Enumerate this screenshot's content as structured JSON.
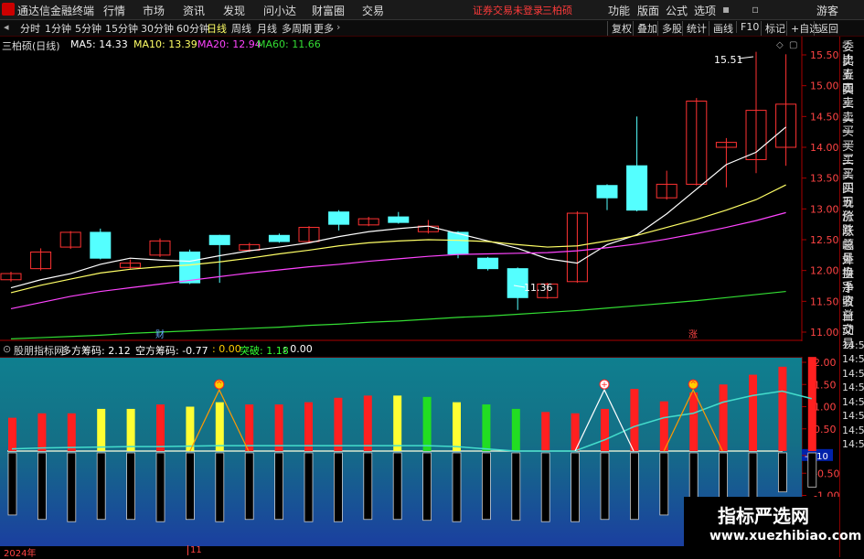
{
  "app": {
    "title": "通达信金融终端"
  },
  "menu": [
    "行情",
    "市场",
    "资讯",
    "发现",
    "问小达",
    "财富圈",
    "交易"
  ],
  "alert": {
    "login": "证券交易未登录",
    "stock": "三柏硕"
  },
  "right_menu": [
    "功能",
    "版面",
    "公式",
    "选项"
  ],
  "guest": "游客",
  "periods": [
    "分时",
    "1分钟",
    "5分钟",
    "15分钟",
    "30分钟",
    "60分钟",
    "日线",
    "周线",
    "月线",
    "多周期",
    "更多"
  ],
  "active_period": "日线",
  "toolbar_right": [
    "复权",
    "叠加",
    "多股",
    "统计",
    "画线",
    "F10",
    "标记",
    "+自选",
    "返回"
  ],
  "main": {
    "stock_label": "三柏硕(日线)",
    "ma": [
      {
        "label": "MA5: 14.33",
        "color": "#ffffff"
      },
      {
        "label": "MA10: 13.39",
        "color": "#ffff66"
      },
      {
        "label": "MA20: 12.94",
        "color": "#ff44ff"
      },
      {
        "label": "MA60: 11.66",
        "color": "#33dd33"
      }
    ],
    "y_ticks": [
      "15.50",
      "15.00",
      "14.50",
      "14.00",
      "13.50",
      "13.00",
      "12.50",
      "12.00",
      "11.50",
      "11.00"
    ],
    "annotations": {
      "high": "15.51",
      "low": "11.36",
      "cai": "财",
      "zhang": "涨"
    },
    "colors": {
      "up": "#ff3232",
      "down": "#54ffff"
    },
    "candles": [
      {
        "o": 11.85,
        "c": 11.95,
        "h": 11.98,
        "l": 11.82
      },
      {
        "o": 12.03,
        "c": 12.3,
        "h": 12.36,
        "l": 12.0
      },
      {
        "o": 12.38,
        "c": 12.62,
        "h": 12.64,
        "l": 12.35
      },
      {
        "o": 12.62,
        "c": 12.2,
        "h": 12.68,
        "l": 12.18
      },
      {
        "o": 12.05,
        "c": 12.12,
        "h": 12.18,
        "l": 12.03
      },
      {
        "o": 12.25,
        "c": 12.48,
        "h": 12.52,
        "l": 12.22
      },
      {
        "o": 12.3,
        "c": 11.8,
        "h": 12.34,
        "l": 11.78
      },
      {
        "o": 12.57,
        "c": 12.42,
        "h": 12.58,
        "l": 11.8
      },
      {
        "o": 12.33,
        "c": 12.42,
        "h": 12.45,
        "l": 12.3
      },
      {
        "o": 12.57,
        "c": 12.47,
        "h": 12.6,
        "l": 12.45
      },
      {
        "o": 12.47,
        "c": 12.7,
        "h": 12.72,
        "l": 12.45
      },
      {
        "o": 12.95,
        "c": 12.75,
        "h": 12.98,
        "l": 12.65
      },
      {
        "o": 12.74,
        "c": 12.84,
        "h": 12.87,
        "l": 12.72
      },
      {
        "o": 12.87,
        "c": 12.78,
        "h": 12.95,
        "l": 12.76
      },
      {
        "o": 12.63,
        "c": 12.72,
        "h": 12.82,
        "l": 12.6
      },
      {
        "o": 12.62,
        "c": 12.27,
        "h": 12.64,
        "l": 12.2
      },
      {
        "o": 12.2,
        "c": 12.03,
        "h": 12.22,
        "l": 12.0
      },
      {
        "o": 12.03,
        "c": 11.56,
        "h": 12.05,
        "l": 11.36
      },
      {
        "o": 11.56,
        "c": 11.78,
        "h": 11.8,
        "l": 11.54
      },
      {
        "o": 11.82,
        "c": 12.93,
        "h": 12.96,
        "l": 11.8
      },
      {
        "o": 13.38,
        "c": 13.18,
        "h": 13.4,
        "l": 12.98
      },
      {
        "o": 13.7,
        "c": 12.98,
        "h": 14.5,
        "l": 12.96
      },
      {
        "o": 13.18,
        "c": 13.4,
        "h": 13.62,
        "l": 13.15
      },
      {
        "o": 13.4,
        "c": 14.75,
        "h": 14.8,
        "l": 13.38
      },
      {
        "o": 14.0,
        "c": 14.08,
        "h": 14.15,
        "l": 13.35
      },
      {
        "o": 13.8,
        "c": 14.6,
        "h": 15.55,
        "l": 13.58
      },
      {
        "o": 14.0,
        "c": 14.7,
        "h": 15.51,
        "l": 13.7
      }
    ],
    "ma5": [
      11.72,
      11.85,
      11.95,
      12.1,
      12.2,
      12.17,
      12.15,
      12.24,
      12.32,
      12.38,
      12.45,
      12.55,
      12.63,
      12.68,
      12.72,
      12.6,
      12.48,
      12.36,
      12.19,
      12.12,
      12.42,
      12.58,
      12.92,
      13.32,
      13.72,
      13.92,
      14.33
    ],
    "ma10": [
      11.64,
      11.76,
      11.86,
      11.96,
      12.02,
      12.06,
      12.09,
      12.14,
      12.2,
      12.27,
      12.33,
      12.4,
      12.45,
      12.48,
      12.5,
      12.49,
      12.47,
      12.42,
      12.38,
      12.4,
      12.48,
      12.57,
      12.7,
      12.83,
      12.98,
      13.15,
      13.39
    ],
    "ma20": [
      11.38,
      11.48,
      11.58,
      11.66,
      11.72,
      11.78,
      11.84,
      11.9,
      11.96,
      12.01,
      12.06,
      12.1,
      12.15,
      12.19,
      12.23,
      12.26,
      12.27,
      12.28,
      12.29,
      12.32,
      12.37,
      12.43,
      12.51,
      12.6,
      12.7,
      12.81,
      12.94
    ],
    "ma60": [
      10.89,
      10.91,
      10.93,
      10.95,
      10.98,
      11.0,
      11.02,
      11.04,
      11.06,
      11.08,
      11.11,
      11.13,
      11.16,
      11.18,
      11.21,
      11.24,
      11.26,
      11.29,
      11.32,
      11.35,
      11.39,
      11.43,
      11.47,
      11.51,
      11.56,
      11.61,
      11.66
    ]
  },
  "sub": {
    "title": "股朋指标网",
    "items": [
      {
        "label": "多方筹码: 2.12",
        "color": "#ffffff"
      },
      {
        "label": "空方筹码: -0.77",
        "color": "#ffffff"
      },
      {
        "label": ": 0.00",
        "color": "#ffcc00"
      },
      {
        "label": "突破: 1.18",
        "color": "#33ff33"
      },
      {
        "label": ": 0.00",
        "color": "#ffffff"
      }
    ],
    "y_ticks": [
      "2.00",
      "1.50",
      "1.00",
      "0.50",
      "-0.10",
      "-0.50",
      "-1.00",
      "-1.50"
    ],
    "bar_values": [
      0.75,
      0.85,
      0.85,
      0.95,
      0.95,
      1.05,
      1.0,
      1.1,
      1.05,
      1.05,
      1.1,
      1.2,
      1.25,
      1.25,
      1.22,
      1.1,
      1.05,
      0.95,
      0.88,
      0.85,
      0.95,
      1.4,
      1.12,
      1.32,
      1.5,
      1.72,
      1.9,
      2.12
    ],
    "bar_colors": [
      "r",
      "r",
      "r",
      "y",
      "y",
      "r",
      "y",
      "y",
      "r",
      "r",
      "r",
      "r",
      "r",
      "y",
      "g",
      "y",
      "g",
      "g",
      "r",
      "r",
      "r",
      "r",
      "r",
      "r",
      "r",
      "r",
      "r",
      "r"
    ],
    "neg_values": [
      -1.4,
      -1.5,
      -1.55,
      -1.5,
      -1.5,
      -1.55,
      -1.5,
      -1.55,
      -1.5,
      -1.5,
      -1.55,
      -1.55,
      -1.5,
      -1.5,
      -1.52,
      -1.55,
      -1.5,
      -1.52,
      -1.55,
      -1.55,
      -1.5,
      -1.5,
      -1.4,
      -1.3,
      -1.22,
      -1.0,
      -0.88,
      -0.77
    ],
    "line_values": [
      0.05,
      0.07,
      0.08,
      0.09,
      0.1,
      0.1,
      0.11,
      0.12,
      0.12,
      0.12,
      0.12,
      0.12,
      0.12,
      0.12,
      0.12,
      0.1,
      0.05,
      0.0,
      0.0,
      0.0,
      0.25,
      0.55,
      0.75,
      0.85,
      1.1,
      1.25,
      1.35,
      1.18
    ],
    "signals": [
      {
        "idx": 7,
        "kind": "up",
        "label": "^"
      },
      {
        "idx": 20,
        "kind": "plus",
        "label": "+"
      },
      {
        "idx": 23,
        "kind": "up",
        "label": "^"
      }
    ]
  },
  "sidebar": [
    "委比",
    "卖五",
    "卖四",
    "卖三",
    "卖二",
    "卖一",
    "买一",
    "买二",
    "买三",
    "买四",
    "买五",
    "现价",
    "涨跌",
    "涨幅",
    "总量",
    "外盘",
    "换手",
    "净资",
    "收益",
    "自动",
    "交易",
    "14:56",
    "14:56",
    "14:56",
    "14:56",
    "14:56",
    "14:56",
    "14:56",
    "14:56"
  ],
  "bottom_axis": {
    "year": "2024年",
    "month": "11"
  },
  "watermark": {
    "cn": "指标严选网",
    "url": "www.xuezhibiao.com"
  }
}
